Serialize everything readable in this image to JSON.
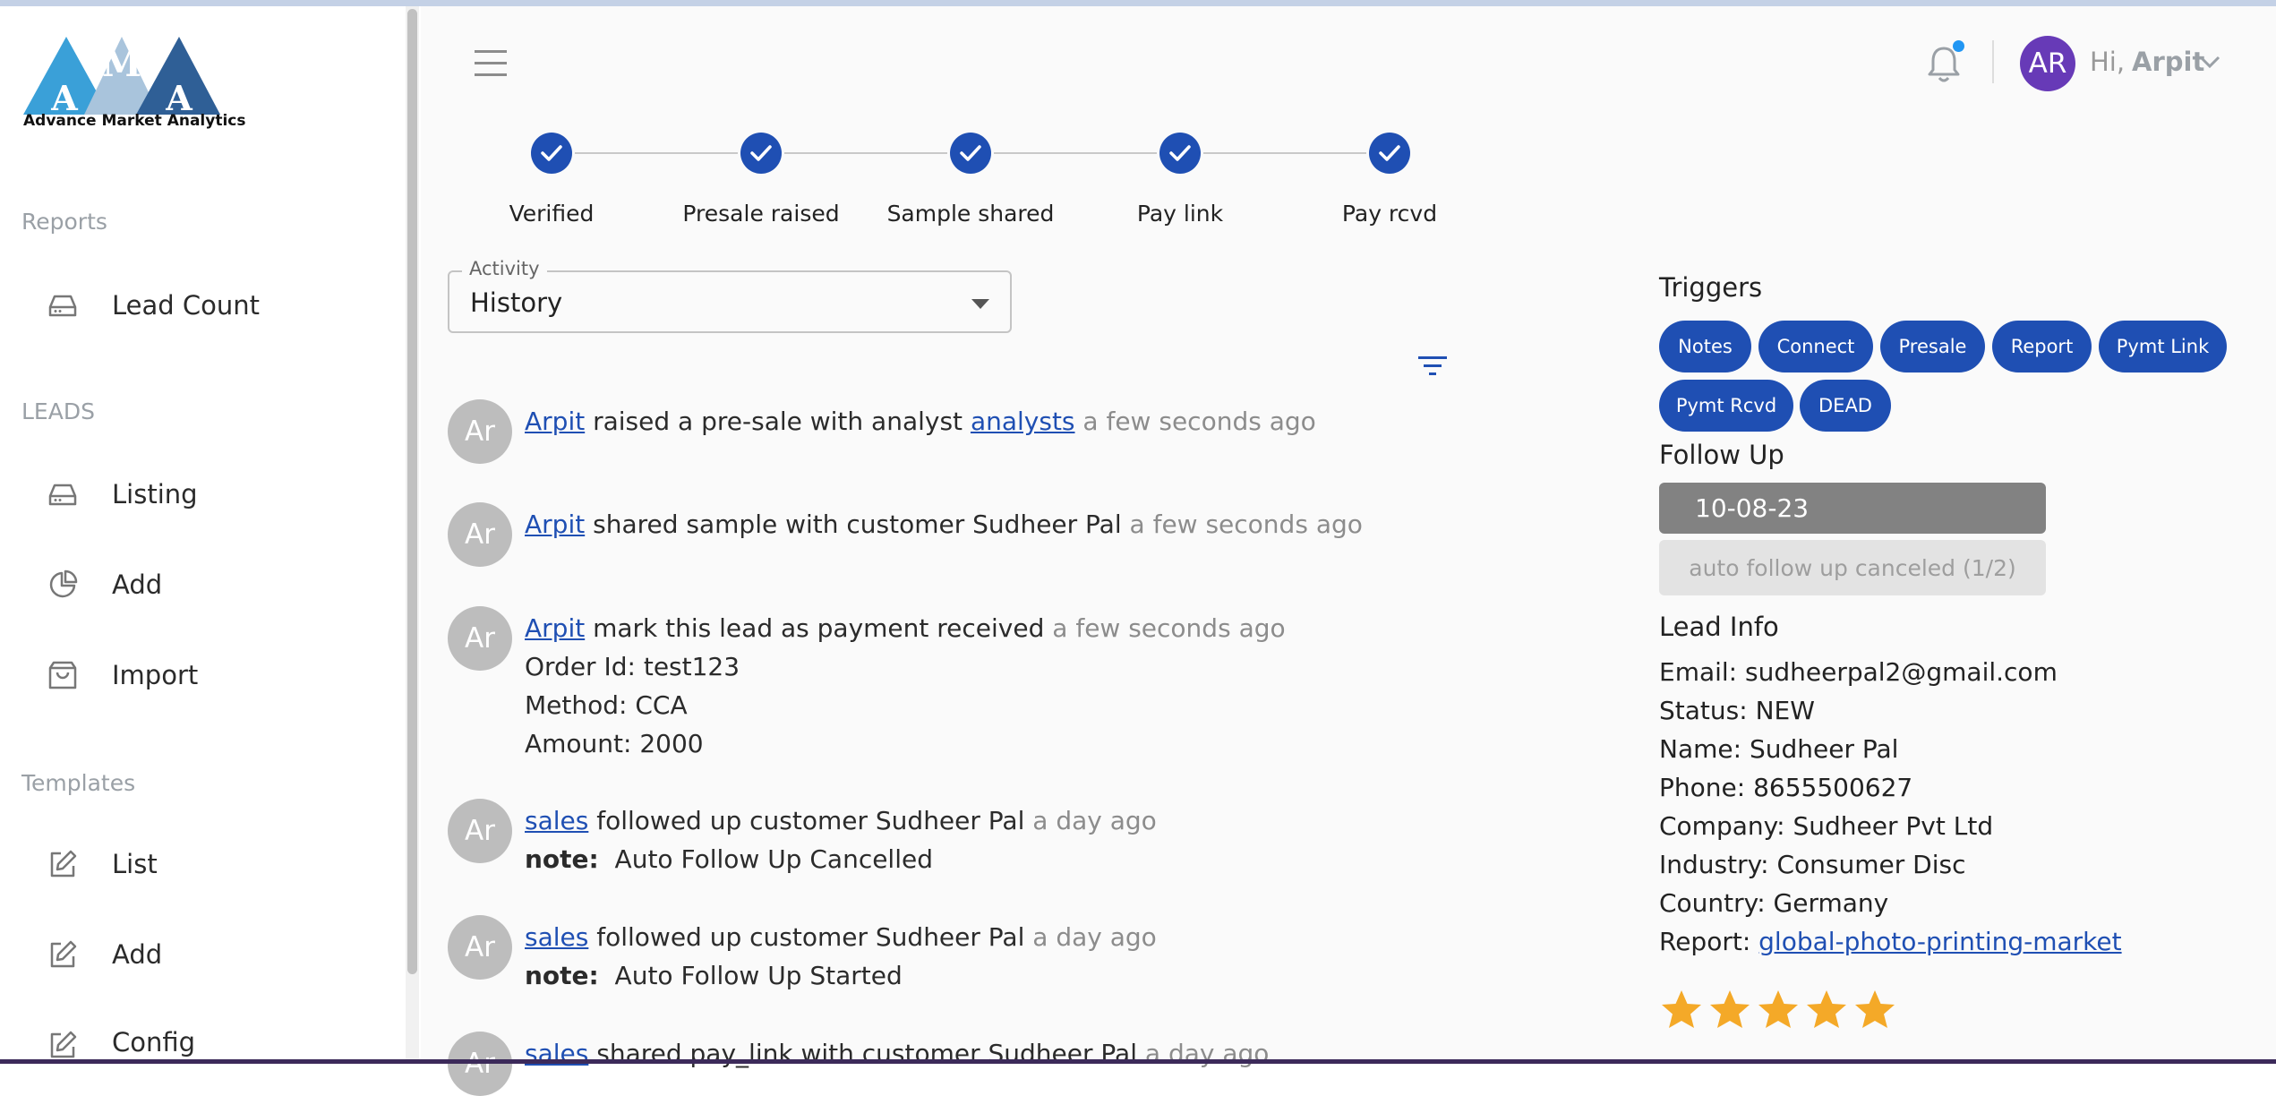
{
  "brand": {
    "logo_letters": [
      "A",
      "M",
      "A"
    ],
    "name": "Advance Market Analytics"
  },
  "sidebar": {
    "sections": [
      {
        "title": "Reports",
        "items": [
          {
            "label": "Lead Count",
            "icon": "inbox-icon"
          }
        ]
      },
      {
        "title": "LEADS",
        "items": [
          {
            "label": "Listing",
            "icon": "inbox-icon"
          },
          {
            "label": "Add",
            "icon": "pie-chart-icon"
          },
          {
            "label": "Import",
            "icon": "shopping-bag-icon"
          }
        ]
      },
      {
        "title": "Templates",
        "items": [
          {
            "label": "List",
            "icon": "edit-icon"
          },
          {
            "label": "Add",
            "icon": "edit-icon"
          },
          {
            "label": "Config",
            "icon": "edit-icon"
          }
        ]
      }
    ]
  },
  "header": {
    "greeting": "Hi,",
    "user_name": "Arpit",
    "avatar_initials": "AR",
    "notification_dot": true
  },
  "stepper": {
    "steps": [
      "Verified",
      "Presale raised",
      "Sample shared",
      "Pay link",
      "Pay rcvd"
    ],
    "completed": 5
  },
  "activity": {
    "legend": "Activity",
    "value": "History"
  },
  "history": [
    {
      "avatar": "Ar",
      "parts": [
        {
          "t": "Arpit",
          "k": "link"
        },
        {
          "t": " raised a pre-sale with analyst "
        },
        {
          "t": "analysts",
          "k": "link"
        },
        {
          "t": " a few seconds ago",
          "k": "time"
        }
      ],
      "details": []
    },
    {
      "avatar": "Ar",
      "parts": [
        {
          "t": "Arpit",
          "k": "link"
        },
        {
          "t": " shared sample with customer Sudheer Pal"
        },
        {
          "t": " a few seconds ago",
          "k": "time"
        }
      ],
      "details": []
    },
    {
      "avatar": "Ar",
      "parts": [
        {
          "t": "Arpit",
          "k": "link"
        },
        {
          "t": " mark this lead as payment received"
        },
        {
          "t": " a few seconds ago",
          "k": "time"
        }
      ],
      "details": [
        "Order Id: test123",
        "Method: CCA",
        "Amount: 2000"
      ]
    },
    {
      "avatar": "Ar",
      "parts": [
        {
          "t": "sales",
          "k": "link"
        },
        {
          "t": " followed up customer Sudheer Pal"
        },
        {
          "t": " a day ago",
          "k": "time"
        }
      ],
      "note_label": "note:",
      "note": "Auto Follow Up Cancelled"
    },
    {
      "avatar": "Ar",
      "parts": [
        {
          "t": "sales",
          "k": "link"
        },
        {
          "t": " followed up customer Sudheer Pal"
        },
        {
          "t": " a day ago",
          "k": "time"
        }
      ],
      "note_label": "note:",
      "note": "Auto Follow Up Started"
    },
    {
      "avatar": "Ar",
      "parts": [
        {
          "t": "sales",
          "k": "link"
        },
        {
          "t": " shared pay_link with customer Sudheer Pal"
        },
        {
          "t": " a day ago",
          "k": "time"
        }
      ]
    }
  ],
  "triggers": {
    "title": "Triggers",
    "chips": [
      "Notes",
      "Connect",
      "Presale",
      "Report",
      "Pymt Link",
      "Pymt Rcvd",
      "DEAD"
    ]
  },
  "follow_up": {
    "title": "Follow Up",
    "date": "10-08-23",
    "status": "auto follow up canceled (1/2)"
  },
  "lead_info": {
    "title": "Lead Info",
    "rows": [
      {
        "label": "Email:",
        "value": "sudheerpal2@gmail.com"
      },
      {
        "label": "Status:",
        "value": "NEW"
      },
      {
        "label": "Name:",
        "value": "Sudheer Pal"
      },
      {
        "label": "Phone:",
        "value": "8655500627"
      },
      {
        "label": "Company:",
        "value": "Sudheer Pvt Ltd"
      },
      {
        "label": "Industry:",
        "value": "Consumer Disc"
      },
      {
        "label": "Country:",
        "value": "Germany"
      },
      {
        "label": "Report:",
        "value": "global-photo-printing-market",
        "link": true
      }
    ]
  },
  "rating": {
    "value": 5,
    "max": 5
  },
  "colors": {
    "primary": "#1f4fb3",
    "avatar": "#673ab7",
    "star": "#f4a928",
    "muted": "#8c8c8c"
  }
}
